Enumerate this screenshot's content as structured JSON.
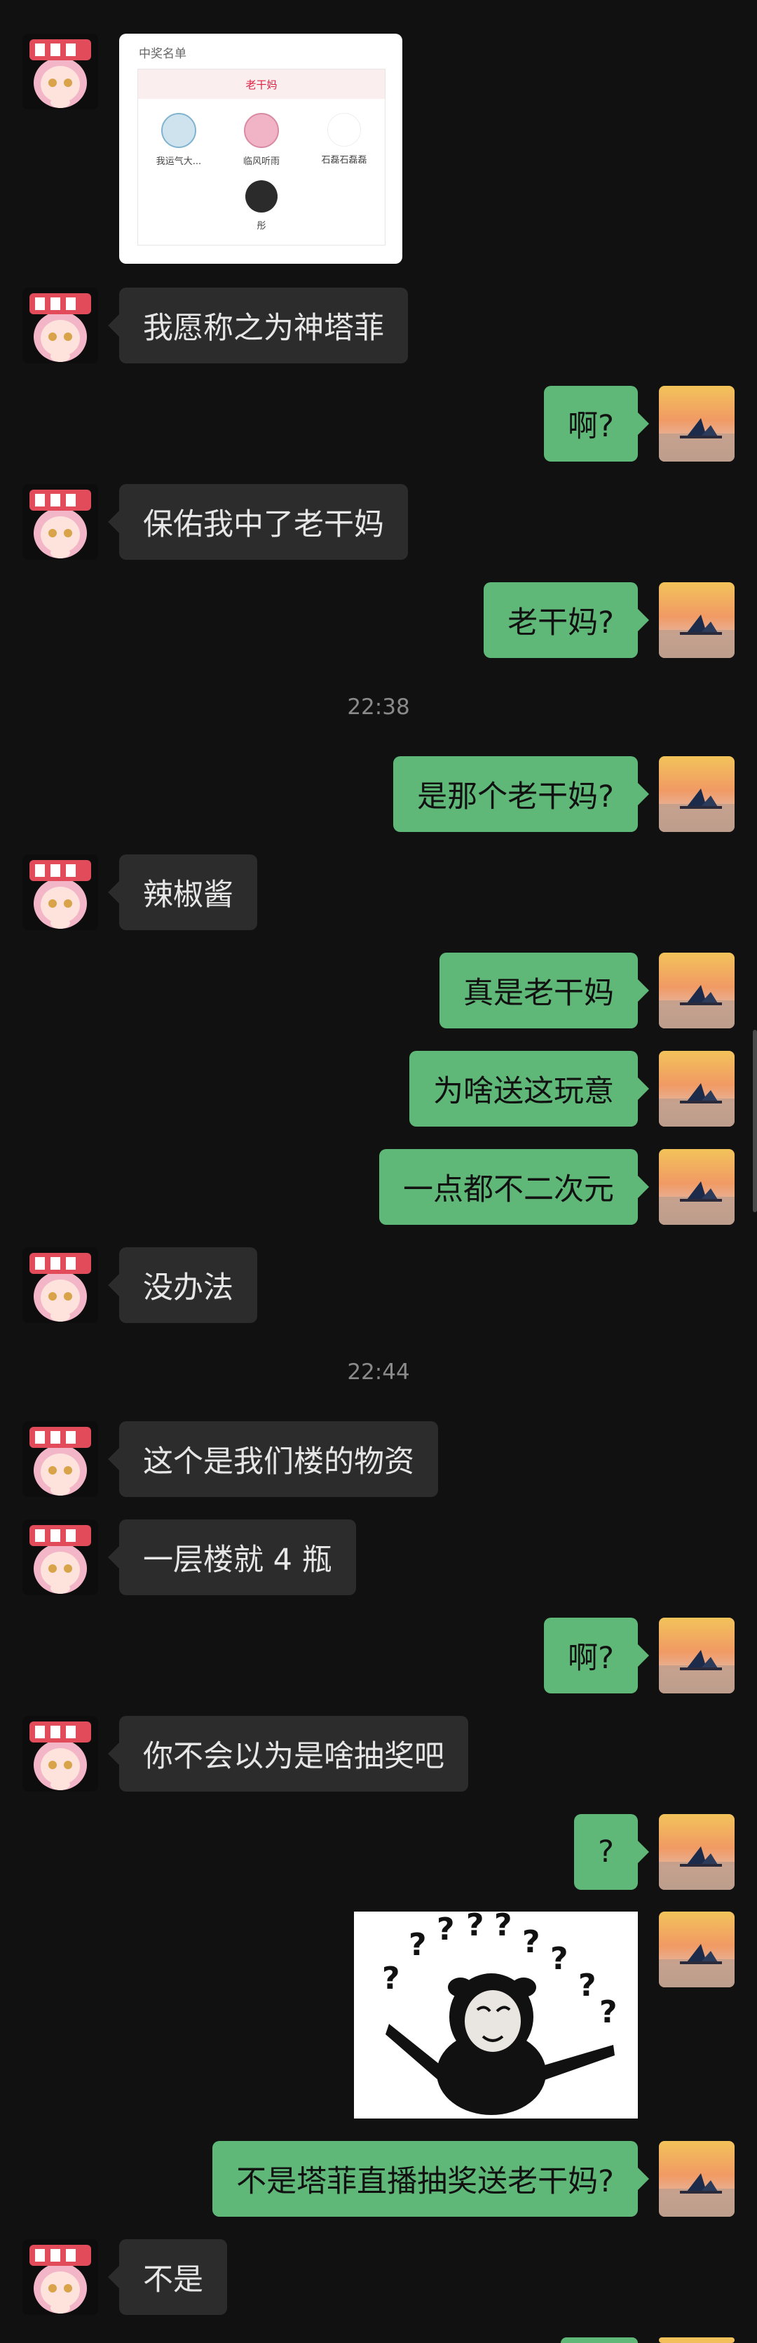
{
  "card": {
    "title": "中奖名单",
    "prize": "老干妈",
    "winners": [
      "我运气大...",
      "临风听雨",
      "石磊石磊磊",
      "彤"
    ]
  },
  "messages": {
    "m1": "我愿称之为神塔菲",
    "m2": "啊?",
    "m3": "保佑我中了老干妈",
    "m4": "老干妈?",
    "t1": "22:38",
    "m5": "是那个老干妈?",
    "m6": "辣椒酱",
    "m7": "真是老干妈",
    "m8": "为啥送这玩意",
    "m9": "一点都不二次元",
    "m10": "没办法",
    "t2": "22:44",
    "m11": "这个是我们楼的物资",
    "m12": "一层楼就 4 瓶",
    "m13": "啊?",
    "m14": "你不会以为是啥抽奖吧",
    "m15": "?",
    "m16": "不是塔菲直播抽奖送老干妈?",
    "m17": "不是"
  },
  "colors": {
    "background": "#111111",
    "incoming_bubble": "#2c2c2c",
    "outgoing_bubble": "#5fb878",
    "timestamp": "#8a8a8a"
  }
}
